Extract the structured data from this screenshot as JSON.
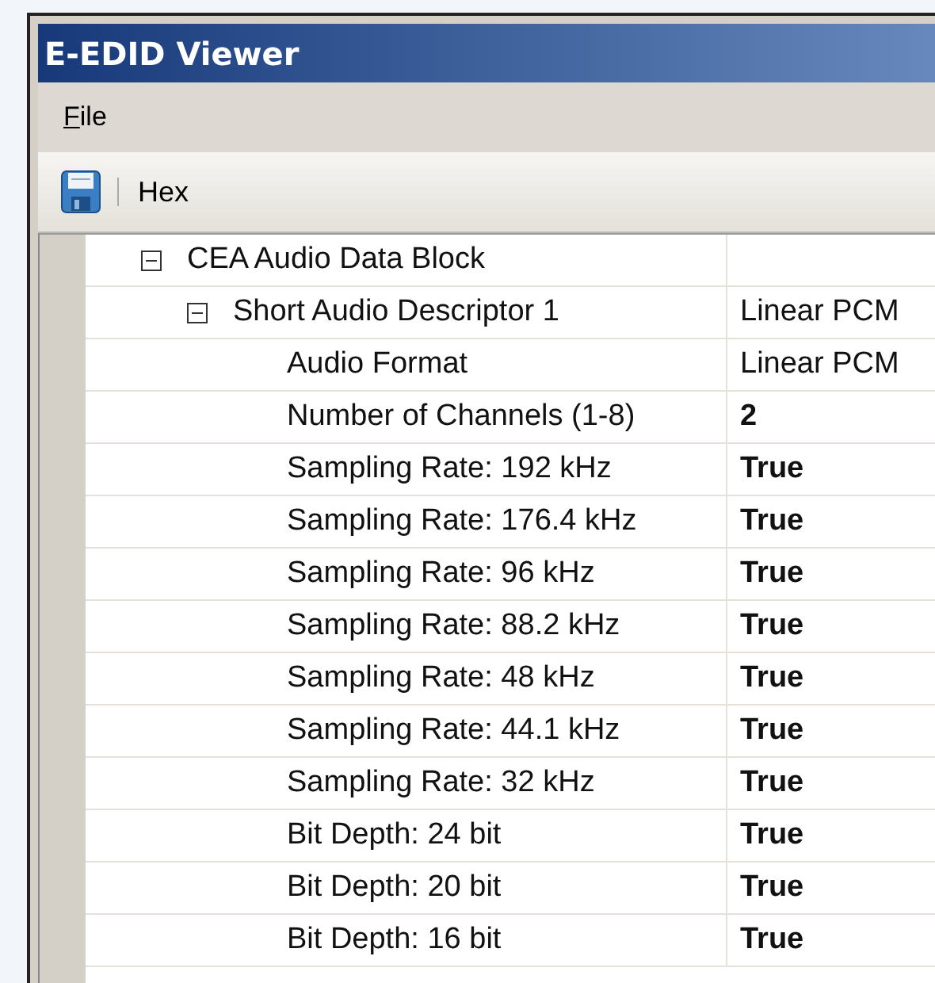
{
  "window": {
    "title": "E-EDID Viewer"
  },
  "menu": [
    {
      "label": "File"
    }
  ],
  "toolbar": {
    "buttons": [
      {
        "kind": "save"
      },
      {
        "kind": "text",
        "label": "Hex"
      }
    ]
  },
  "tree": [
    {
      "name": "CEA Audio Data Block",
      "expanded": true,
      "children": [
        {
          "name": "Short Audio Descriptor 1",
          "value": "Linear PCM",
          "modified": false,
          "expanded": true,
          "children": [
            {
              "name": "Audio Format",
              "value": "Linear PCM",
              "modified": false
            },
            {
              "name": "Number of Channels (1-8)",
              "value": "2",
              "modified": true
            },
            {
              "name": "Sampling Rate: 192 kHz",
              "value": "True",
              "modified": true
            },
            {
              "name": "Sampling Rate: 176.4 kHz",
              "value": "True",
              "modified": true
            },
            {
              "name": "Sampling Rate: 96 kHz",
              "value": "True",
              "modified": true
            },
            {
              "name": "Sampling Rate: 88.2 kHz",
              "value": "True",
              "modified": true
            },
            {
              "name": "Sampling Rate: 48 kHz",
              "value": "True",
              "modified": true
            },
            {
              "name": "Sampling Rate: 44.1 kHz",
              "value": "True",
              "modified": true
            },
            {
              "name": "Sampling Rate: 32 kHz",
              "value": "True",
              "modified": true
            },
            {
              "name": "Bit Depth: 24 bit",
              "value": "True",
              "modified": true
            },
            {
              "name": "Bit Depth: 20 bit",
              "value": "True",
              "modified": true
            },
            {
              "name": "Bit Depth: 16 bit",
              "value": "True",
              "modified": true
            }
          ]
        }
      ]
    }
  ]
}
